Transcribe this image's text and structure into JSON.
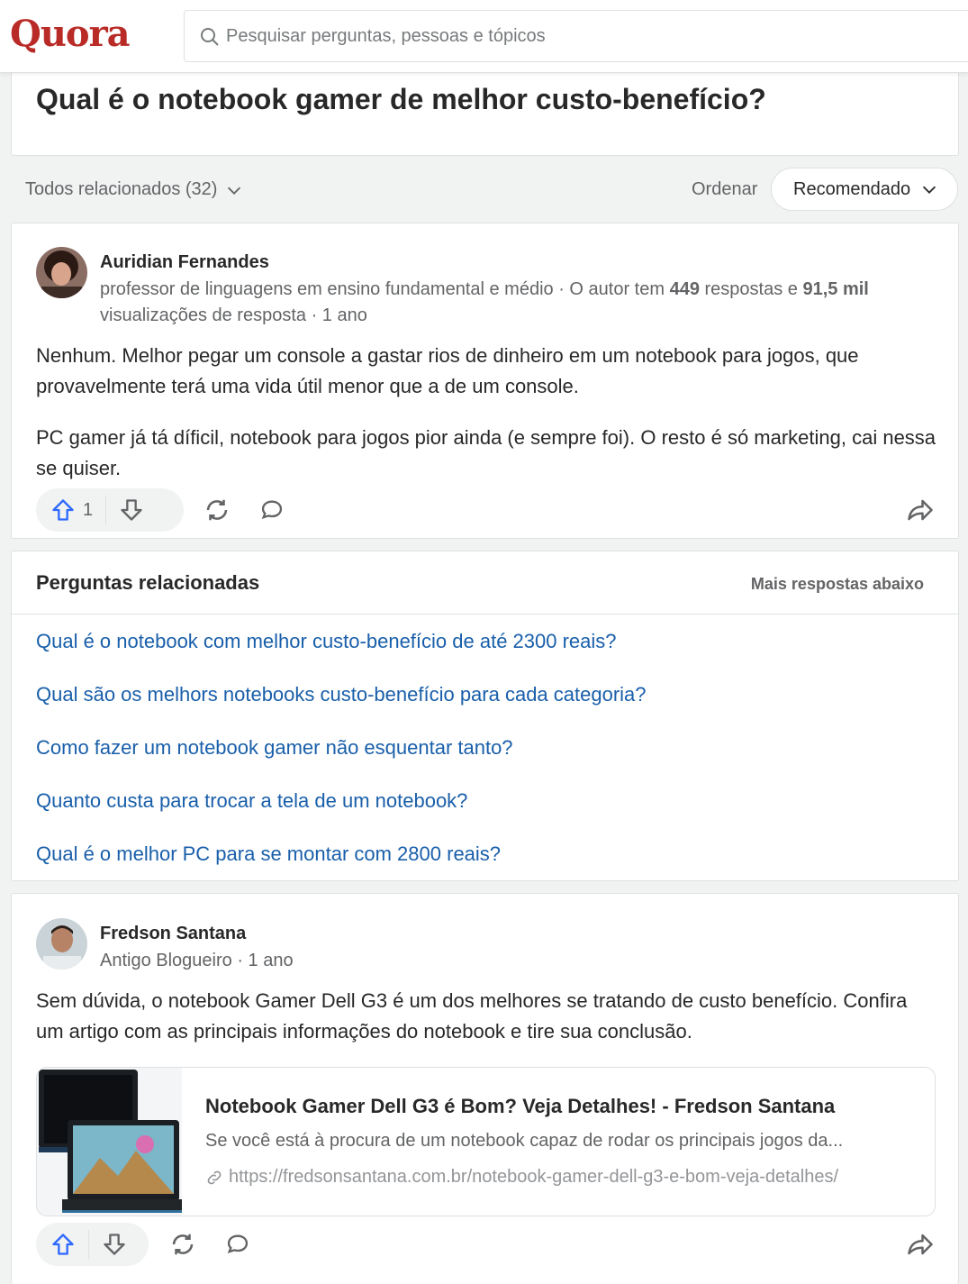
{
  "header": {
    "logo": "Quora",
    "search_placeholder": "Pesquisar perguntas, pessoas e tópicos"
  },
  "question": {
    "title": "Qual é o notebook gamer de melhor custo-benefício?"
  },
  "filters": {
    "all_related": "Todos relacionados (32)",
    "sort_label": "Ordenar",
    "sort_value": "Recomendado"
  },
  "answers": [
    {
      "author": "Auridian Fernandes",
      "credential_prefix": "professor de linguagens em ensino fundamental e médio · O autor tem ",
      "answers_count": "449",
      "credential_mid": " respostas e ",
      "views_count": "91,5 mil",
      "credential_suffix": " visualizações de resposta · 1 ano",
      "paragraphs": [
        "Nenhum. Melhor pegar um console a gastar rios de dinheiro em um notebook para jogos, que provavelmente terá uma vida útil menor que a de um console.",
        "PC gamer já tá díficil, notebook para jogos pior ainda (e sempre foi). O resto é só marketing, cai nessa se quiser."
      ],
      "upvotes": "1"
    },
    {
      "author": "Fredson Santana",
      "credential": "Antigo Blogueiro · 1 ano",
      "paragraphs": [
        "Sem dúvida, o notebook Gamer Dell G3 é um dos melhores se tratando de custo benefício. Confira um artigo com as principais informações do notebook e tire sua conclusão."
      ],
      "link_preview": {
        "title": "Notebook Gamer Dell G3 é Bom? Veja Detalhes! - Fredson Santana",
        "description": "Se você está à procura de um notebook capaz de rodar os principais jogos da...",
        "url": "https://fredsonsantana.com.br/notebook-gamer-dell-g3-e-bom-veja-detalhes/"
      }
    }
  ],
  "related": {
    "title": "Perguntas relacionadas",
    "more": "Mais respostas abaixo",
    "questions": [
      "Qual é o notebook com melhor custo-benefício de até 2300 reais?",
      "Qual são os melhors notebooks custo-benefício para cada categoria?",
      "Como fazer um notebook gamer não esquentar tanto?",
      "Quanto custa para trocar a tela de um notebook?",
      "Qual é o melhor PC para se montar com 2800 reais?"
    ]
  },
  "colors": {
    "brand": "#b92b27",
    "link": "#195faa",
    "upvote": "#2e69ff"
  }
}
